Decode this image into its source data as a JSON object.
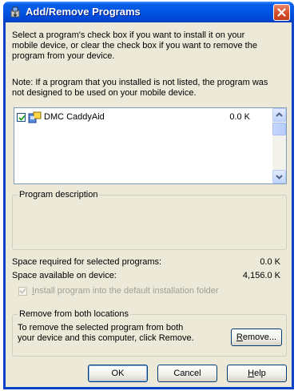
{
  "window": {
    "title": "Add/Remove Programs"
  },
  "instructions": {
    "line1": "Select a program's check box if you want to install it on your",
    "line2": "mobile device, or clear the check box if you want to remove the",
    "line3": "program from your device.",
    "note1": "Note:  If a program that you installed is not listed, the program was",
    "note2": "not designed to be used on your mobile device."
  },
  "programs": [
    {
      "name": "DMC CaddyAid",
      "size": "0.0 K",
      "checked": true
    }
  ],
  "description": {
    "label": "Program description",
    "text": ""
  },
  "space": {
    "required_label": "Space required for selected programs:",
    "required_value": "0.0 K",
    "available_label": "Space available on device:",
    "available_value": "4,156.0 K"
  },
  "install_default": {
    "label_first": "I",
    "label_rest": "nstall program into the default installation folder",
    "checked": true,
    "enabled": false
  },
  "remove_group": {
    "label": "Remove from both locations",
    "text1": "To remove the selected program from both",
    "text2": "your device and this computer, click Remove.",
    "button_first": "R",
    "button_rest": "emove..."
  },
  "buttons": {
    "ok": "OK",
    "cancel": "Cancel",
    "help_first": "H",
    "help_rest": "elp"
  },
  "colors": {
    "titlebar": "#0055e5",
    "face": "#ece9d8",
    "close": "#d8502c"
  },
  "icons": {
    "title": "add-remove-programs-icon",
    "close": "close-icon",
    "program": "program-icon"
  }
}
